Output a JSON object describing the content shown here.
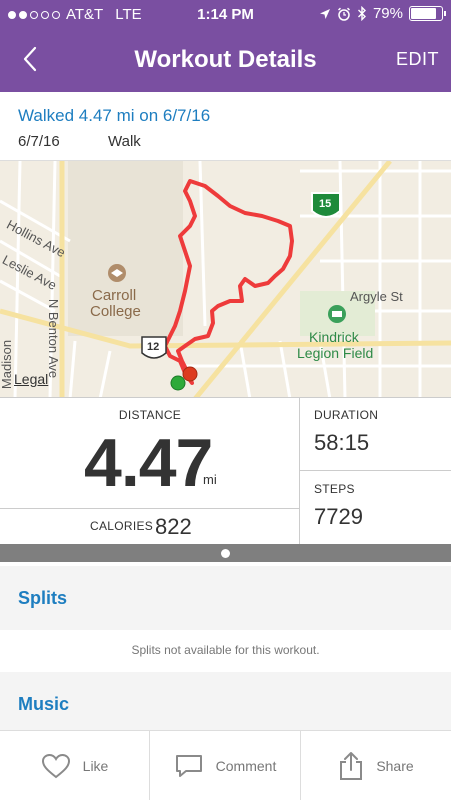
{
  "status_bar": {
    "carrier": "AT&T",
    "network": "LTE",
    "time": "1:14 PM",
    "battery": "79%",
    "signal_bars_filled": 2,
    "signal_bars_total": 5
  },
  "nav": {
    "title": "Workout Details",
    "edit_label": "EDIT",
    "back_icon": "chevron-left-icon"
  },
  "summary": {
    "headline": "Walked 4.47 mi on 6/7/16",
    "date": "6/7/16",
    "activity": "Walk"
  },
  "map": {
    "labels": {
      "hollins": "Hollins Ave",
      "leslie": "Leslie Ave",
      "benton": "N Benton Ave",
      "madison": "Madison",
      "argyle": "Argyle St",
      "carroll_line1": "Carroll",
      "carroll_line2": "College",
      "kindrick_line1": "Kindrick",
      "kindrick_line2": "Legion Field",
      "hwy12": "12",
      "i15": "15"
    },
    "legal": "Legal",
    "route_color": "#ee3b3b",
    "start_color": "#2eaa3a",
    "end_color": "#dd3b1f"
  },
  "stats": {
    "distance_label": "DISTANCE",
    "distance_value": "4.47",
    "distance_unit": "mi",
    "calories_label": "CALORIES",
    "calories_value": "822",
    "duration_label": "DURATION",
    "duration_value": "58:15",
    "steps_label": "STEPS",
    "steps_value": "7729"
  },
  "splits": {
    "title": "Splits",
    "note": "Splits not available for this workout."
  },
  "music": {
    "title": "Music"
  },
  "actions": {
    "like": "Like",
    "comment": "Comment",
    "share": "Share"
  },
  "colors": {
    "header": "#7a4fa1",
    "link": "#1e7ec0"
  }
}
